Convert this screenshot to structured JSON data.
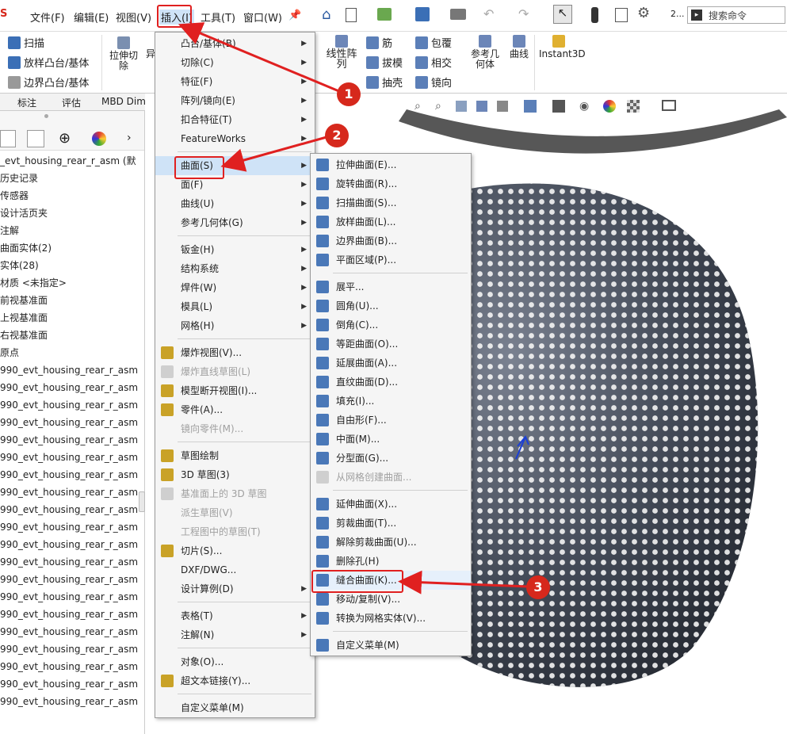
{
  "menubar": {
    "items": [
      {
        "label": "文件(F)"
      },
      {
        "label": "编辑(E)"
      },
      {
        "label": "视图(V)"
      },
      {
        "label": "插入(I)"
      },
      {
        "label": "工具(T)"
      },
      {
        "label": "窗口(W)"
      }
    ],
    "search_placeholder": "搜索命令",
    "version_hint": "2..."
  },
  "commands": {
    "sweep": "扫描",
    "loft": "放样凸台/基体",
    "boundary": "边界凸台/基体",
    "extrude_cut": "拉伸切除",
    "partial_label": "异",
    "linear_pattern": "线性阵列",
    "rib": "筋",
    "draft": "拔模",
    "shell": "抽壳",
    "wrap": "包覆",
    "intersect": "相交",
    "mirror": "镜向",
    "ref_geometry": "参考几何体",
    "curves": "曲线",
    "instant3d": "Instant3D"
  },
  "tabs": [
    {
      "label": "标注"
    },
    {
      "label": "评估"
    },
    {
      "label": "MBD Dimens"
    }
  ],
  "tree": {
    "root": "_evt_housing_rear_r_asm (默",
    "items": [
      "历史记录",
      "传感器",
      "设计活页夹",
      "注解",
      "曲面实体(2)",
      "实体(28)",
      "材质 <未指定>",
      "前视基准面",
      "上视基准面",
      "右视基准面",
      "原点"
    ],
    "repeat_label": "990_evt_housing_rear_r_asm",
    "repeat_count": 20
  },
  "insert_menu": {
    "items": [
      {
        "label": "凸台/基体(B)",
        "arrow": true
      },
      {
        "label": "切除(C)",
        "arrow": true
      },
      {
        "label": "特征(F)",
        "arrow": true
      },
      {
        "label": "阵列/镜向(E)",
        "arrow": true
      },
      {
        "label": "扣合特征(T)",
        "arrow": true
      },
      {
        "label": "FeatureWorks",
        "arrow": true
      },
      {
        "sep": true
      },
      {
        "label": "曲面(S)",
        "arrow": true,
        "selected": true
      },
      {
        "label": "面(F)",
        "arrow": true
      },
      {
        "label": "曲线(U)",
        "arrow": true
      },
      {
        "label": "参考几何体(G)",
        "arrow": true
      },
      {
        "sep": true
      },
      {
        "label": "钣金(H)",
        "arrow": true
      },
      {
        "label": "结构系统",
        "arrow": true
      },
      {
        "label": "焊件(W)",
        "arrow": true
      },
      {
        "label": "模具(L)",
        "arrow": true
      },
      {
        "label": "网格(H)",
        "arrow": true
      },
      {
        "sep": true
      },
      {
        "label": "爆炸视图(V)...",
        "icon": true
      },
      {
        "label": "爆炸直线草图(L)",
        "disabled": true,
        "icon": true
      },
      {
        "label": "模型断开视图(I)...",
        "icon": true
      },
      {
        "label": "零件(A)...",
        "icon": true
      },
      {
        "label": "镜向零件(M)...",
        "disabled": true
      },
      {
        "sep": true
      },
      {
        "label": "草图绘制",
        "icon": true
      },
      {
        "label": "3D 草图(3)",
        "icon": true
      },
      {
        "label": "基准面上的 3D 草图",
        "disabled": true,
        "icon": true
      },
      {
        "label": "派生草图(V)",
        "disabled": true
      },
      {
        "label": "工程图中的草图(T)",
        "disabled": true
      },
      {
        "label": "切片(S)...",
        "icon": true
      },
      {
        "label": "DXF/DWG..."
      },
      {
        "label": "设计算例(D)",
        "arrow": true
      },
      {
        "sep": true
      },
      {
        "label": "表格(T)",
        "arrow": true
      },
      {
        "label": "注解(N)",
        "arrow": true
      },
      {
        "sep": true
      },
      {
        "label": "对象(O)..."
      },
      {
        "label": "超文本链接(Y)...",
        "icon": true
      },
      {
        "sep": true
      },
      {
        "label": "自定义菜单(M)"
      }
    ]
  },
  "surface_menu": {
    "items": [
      {
        "label": "拉伸曲面(E)..."
      },
      {
        "label": "旋转曲面(R)..."
      },
      {
        "label": "扫描曲面(S)..."
      },
      {
        "label": "放样曲面(L)..."
      },
      {
        "label": "边界曲面(B)..."
      },
      {
        "label": "平面区域(P)..."
      },
      {
        "sep": true
      },
      {
        "label": "展平..."
      },
      {
        "label": "圆角(U)..."
      },
      {
        "label": "倒角(C)..."
      },
      {
        "label": "等距曲面(O)..."
      },
      {
        "label": "延展曲面(A)..."
      },
      {
        "label": "直纹曲面(D)..."
      },
      {
        "label": "填充(I)..."
      },
      {
        "label": "自由形(F)..."
      },
      {
        "label": "中面(M)..."
      },
      {
        "label": "分型面(G)..."
      },
      {
        "label": "从网格创建曲面...",
        "disabled": true
      },
      {
        "sep": true
      },
      {
        "label": "延伸曲面(X)..."
      },
      {
        "label": "剪裁曲面(T)..."
      },
      {
        "label": "解除剪裁曲面(U)..."
      },
      {
        "label": "删除孔(H)"
      },
      {
        "label": "缝合曲面(K)...",
        "highlight": true
      },
      {
        "label": "移动/复制(V)..."
      },
      {
        "label": "转换为网格实体(V)..."
      },
      {
        "sep": true
      },
      {
        "label": "自定义菜单(M)"
      }
    ]
  },
  "callouts": [
    "1",
    "2",
    "3"
  ],
  "colors": {
    "accent": "#e02020",
    "menu_bg": "#f5f5f5",
    "model": "#3f4652"
  }
}
